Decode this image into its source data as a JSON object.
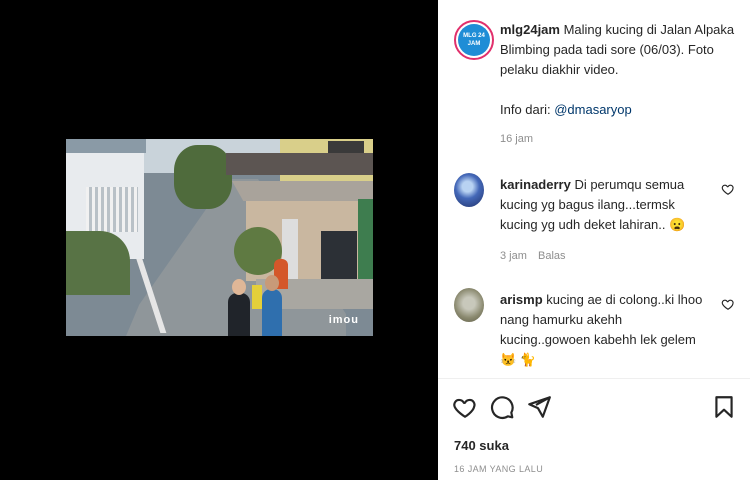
{
  "post": {
    "username": "mlg24jam",
    "avatar_text": "MLG 24 JAM",
    "caption_text": " Maling kucing di Jalan Alpaka Blimbing pada tadi sore (06/03). Foto pelaku diakhir video.",
    "info_prefix": "Info dari: ",
    "info_mention": "@dmasaryop",
    "time_ago": "16 jam"
  },
  "video": {
    "watermark": "imou"
  },
  "comments": [
    {
      "username": "karinaderry",
      "text": " Di perumqu semua kucing yg bagus ilang...termsk kucing yg udh deket lahiran..",
      "emoji": "😦",
      "time_ago": "3 jam",
      "reply_label": "Balas"
    },
    {
      "username": "arismp",
      "text": " kucing ae di colong..ki lhoo nang hamurku akehh kucing..gowoen kabehh lek gelem",
      "emojis": "😾 🐈"
    }
  ],
  "actions": {
    "like_icon": "heart-icon",
    "comment_icon": "comment-icon",
    "share_icon": "paper-plane-icon",
    "save_icon": "bookmark-icon"
  },
  "likes_text": "740 suka",
  "timestamp_text": "16 JAM YANG LALU",
  "colors": {
    "mention": "#00376b",
    "muted": "#8e8e8e",
    "story_ring": "#e1306c",
    "logo_bg": "#1f8dd6"
  }
}
